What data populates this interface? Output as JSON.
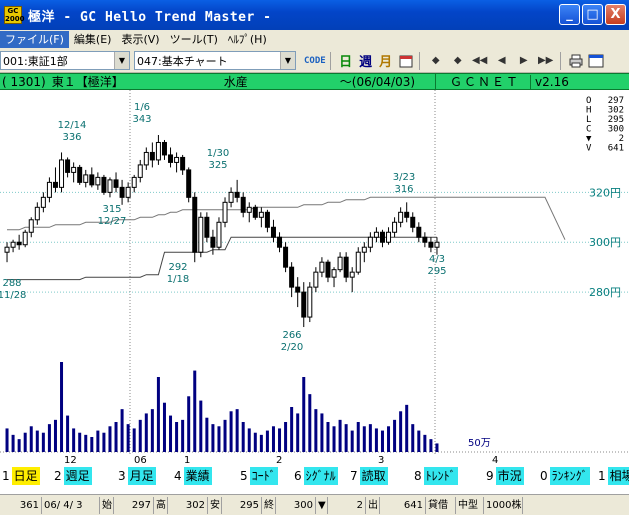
{
  "window": {
    "title": "極洋 - GC Hello Trend Master -",
    "icon_text": "GC 2000",
    "min_glyph": "_",
    "max_glyph": "□",
    "close_glyph": "X"
  },
  "menu": [
    "ファイル(F)",
    "編集(E)",
    "表示(V)",
    "ツール(T)",
    "ﾍﾙﾌﾟ(H)"
  ],
  "toolbar": {
    "market_combo": "001:東証1部",
    "chart_combo": "047:基本チャート",
    "code_label": "CODE",
    "day_label": "日",
    "week_label": "週",
    "month_label": "月",
    "nav": [
      "◆",
      "◆",
      "◀◀",
      "◀",
      "▶",
      "▶▶"
    ]
  },
  "infobar": {
    "code": "( 1301)",
    "market": "東１",
    "name": "【極洋】",
    "sector": "水産",
    "date": "～(06/04/03)",
    "source": "ＧＣＮＥＴ",
    "version": "v2.16"
  },
  "ohlc_panel": {
    "labels": [
      "O",
      "H",
      "L",
      "C",
      "▼",
      "V"
    ],
    "values": [
      "297",
      "302",
      "295",
      "300",
      "2",
      "641"
    ]
  },
  "chart_data": {
    "type": "candlestick",
    "price_axis": {
      "ticks": [
        280,
        300,
        320
      ],
      "tick_labels": [
        "280円",
        "300円",
        "320円"
      ]
    },
    "volume_label": "50万",
    "month_labels": [
      "12",
      "06",
      "1",
      "2",
      "3",
      "4"
    ],
    "annotations": [
      {
        "date": "11/28",
        "price": "288"
      },
      {
        "date": "12/14",
        "price": "336"
      },
      {
        "date": "12/27",
        "price": "315"
      },
      {
        "date": "1/6",
        "price": "343"
      },
      {
        "date": "1/18",
        "price": "292"
      },
      {
        "date": "1/30",
        "price": "325"
      },
      {
        "date": "2/20",
        "price": "266"
      },
      {
        "date": "3/23",
        "price": "316"
      },
      {
        "date": "4/3",
        "price": "295"
      }
    ],
    "bars": [
      [
        296,
        300,
        292,
        298,
        110
      ],
      [
        298,
        301,
        296,
        300,
        80
      ],
      [
        300,
        303,
        297,
        299,
        60
      ],
      [
        299,
        305,
        298,
        304,
        90
      ],
      [
        304,
        310,
        302,
        309,
        120
      ],
      [
        309,
        316,
        307,
        314,
        100
      ],
      [
        314,
        320,
        312,
        318,
        90
      ],
      [
        318,
        326,
        316,
        324,
        130
      ],
      [
        324,
        330,
        320,
        322,
        150
      ],
      [
        322,
        336,
        320,
        333,
        420
      ],
      [
        333,
        334,
        326,
        328,
        170
      ],
      [
        328,
        332,
        324,
        330,
        110
      ],
      [
        330,
        331,
        323,
        324,
        90
      ],
      [
        324,
        329,
        322,
        327,
        80
      ],
      [
        327,
        330,
        322,
        323,
        70
      ],
      [
        323,
        328,
        321,
        326,
        100
      ],
      [
        326,
        327,
        319,
        320,
        90
      ],
      [
        320,
        326,
        318,
        325,
        120
      ],
      [
        325,
        328,
        320,
        322,
        140
      ],
      [
        322,
        325,
        315,
        318,
        200
      ],
      [
        318,
        324,
        316,
        322,
        130
      ],
      [
        322,
        327,
        320,
        326,
        110
      ],
      [
        326,
        333,
        324,
        331,
        150
      ],
      [
        331,
        338,
        329,
        336,
        180
      ],
      [
        336,
        340,
        330,
        333,
        200
      ],
      [
        333,
        343,
        331,
        340,
        350
      ],
      [
        340,
        341,
        333,
        335,
        230
      ],
      [
        335,
        338,
        330,
        332,
        170
      ],
      [
        332,
        336,
        328,
        334,
        140
      ],
      [
        334,
        335,
        327,
        329,
        150
      ],
      [
        329,
        330,
        316,
        318,
        260
      ],
      [
        318,
        320,
        292,
        296,
        380
      ],
      [
        296,
        312,
        294,
        310,
        240
      ],
      [
        310,
        312,
        300,
        302,
        160
      ],
      [
        302,
        305,
        295,
        298,
        130
      ],
      [
        298,
        310,
        297,
        308,
        120
      ],
      [
        308,
        318,
        306,
        316,
        150
      ],
      [
        316,
        322,
        314,
        320,
        190
      ],
      [
        320,
        325,
        316,
        318,
        200
      ],
      [
        318,
        320,
        310,
        312,
        140
      ],
      [
        312,
        316,
        308,
        314,
        110
      ],
      [
        314,
        315,
        309,
        310,
        90
      ],
      [
        310,
        314,
        306,
        312,
        80
      ],
      [
        312,
        313,
        304,
        306,
        100
      ],
      [
        306,
        309,
        300,
        302,
        120
      ],
      [
        302,
        304,
        296,
        298,
        110
      ],
      [
        298,
        300,
        288,
        290,
        140
      ],
      [
        290,
        292,
        278,
        282,
        210
      ],
      [
        282,
        286,
        274,
        280,
        180
      ],
      [
        280,
        284,
        266,
        270,
        350
      ],
      [
        270,
        284,
        268,
        282,
        270
      ],
      [
        282,
        290,
        280,
        288,
        200
      ],
      [
        288,
        294,
        286,
        292,
        180
      ],
      [
        292,
        293,
        284,
        286,
        140
      ],
      [
        286,
        290,
        282,
        289,
        120
      ],
      [
        289,
        296,
        288,
        294,
        150
      ],
      [
        294,
        296,
        284,
        286,
        130
      ],
      [
        286,
        290,
        280,
        288,
        100
      ],
      [
        288,
        298,
        287,
        296,
        140
      ],
      [
        296,
        300,
        292,
        298,
        120
      ],
      [
        298,
        304,
        296,
        302,
        130
      ],
      [
        302,
        306,
        300,
        304,
        110
      ],
      [
        304,
        305,
        298,
        300,
        100
      ],
      [
        300,
        306,
        299,
        304,
        120
      ],
      [
        304,
        310,
        302,
        308,
        150
      ],
      [
        308,
        314,
        306,
        312,
        190
      ],
      [
        312,
        316,
        308,
        310,
        220
      ],
      [
        310,
        312,
        304,
        306,
        130
      ],
      [
        306,
        308,
        300,
        302,
        100
      ],
      [
        302,
        304,
        298,
        300,
        80
      ],
      [
        300,
        302,
        296,
        298,
        60
      ],
      [
        298,
        302,
        295,
        300,
        40
      ]
    ],
    "ma_line": [
      285,
      285,
      285,
      285,
      285,
      285,
      285,
      285,
      285,
      285,
      285,
      285,
      285,
      286,
      286,
      286,
      286,
      286,
      286,
      286,
      286,
      286,
      286,
      287,
      287,
      287,
      296,
      296,
      296,
      296,
      296,
      296,
      296,
      296,
      297,
      297,
      297,
      302,
      302,
      302,
      302,
      302,
      302,
      302,
      302,
      302,
      302,
      302,
      302,
      302,
      302,
      302,
      302,
      302,
      302,
      302,
      302,
      302,
      302,
      302,
      302,
      302,
      302,
      302,
      302,
      302,
      302,
      302,
      302,
      302,
      302,
      302
    ],
    "ma_line_2": [
      305,
      305,
      305,
      306,
      306,
      306,
      306,
      306,
      307,
      307,
      307,
      307,
      307,
      308,
      308,
      308,
      308,
      308,
      309,
      309,
      309,
      309,
      310,
      310,
      310,
      311,
      311,
      312,
      312,
      313,
      313,
      313,
      313,
      313,
      313,
      313,
      313,
      313,
      313,
      313,
      313,
      314,
      314,
      314,
      314,
      314,
      314,
      314,
      314,
      315,
      315,
      315,
      315,
      316,
      316,
      316,
      317,
      317,
      317,
      317,
      318,
      318,
      318,
      318,
      318,
      318,
      318,
      318,
      318,
      318,
      318,
      318
    ]
  },
  "function_buttons": [
    {
      "num": "1",
      "label": "日足",
      "color": "yellow"
    },
    {
      "num": "2",
      "label": "週足",
      "color": "cyan"
    },
    {
      "num": "3",
      "label": "月足",
      "color": "cyan"
    },
    {
      "num": "4",
      "label": "業績",
      "color": "cyan"
    },
    {
      "num": "5",
      "label": "ｺｰﾄﾞ",
      "color": "cyan"
    },
    {
      "num": "6",
      "label": "ｼｸﾞﾅﾙ",
      "color": "cyan"
    },
    {
      "num": "7",
      "label": "読取",
      "color": "cyan"
    },
    {
      "num": "8",
      "label": "ﾄﾚﾝﾄﾞ",
      "color": "cyan"
    },
    {
      "num": "9",
      "label": "市況",
      "color": "cyan"
    },
    {
      "num": "0",
      "label": "ﾗﾝｷﾝｸﾞ",
      "color": "cyan"
    },
    {
      "num": "1",
      "label": "相場",
      "color": "cyan"
    }
  ],
  "statusbar": [
    "361",
    "06/ 4/ 3",
    "始",
    "297",
    "高",
    "302",
    "安",
    "295",
    "終",
    "300",
    "▼",
    "2",
    "出",
    "641",
    "貸借",
    "中型",
    "1000株"
  ]
}
